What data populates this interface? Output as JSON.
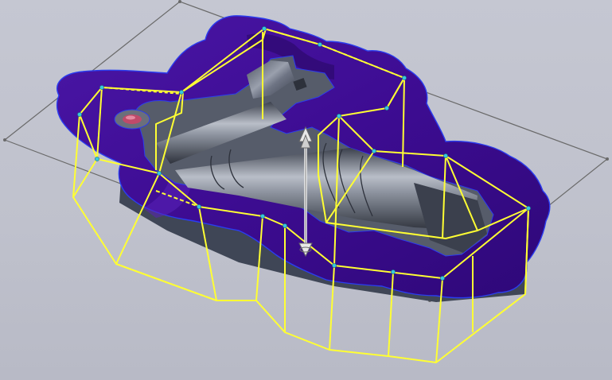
{
  "viewport": {
    "kind": "cad-3d-view",
    "colors": {
      "background": "#c3c5d0",
      "mold_surface": "#3d0c92",
      "mold_surface_light": "#5a23b8",
      "mold_edge": "#2a3df0",
      "cavity_metal": "#5b6271",
      "cavity_metal_light": "#9aa0ad",
      "sketch_lines": "#ffff33",
      "sketch_points": "#36c9e0",
      "bounding_lines": "#6a6a6a",
      "pull_arrow": "#f2f2f2"
    }
  },
  "objects": {
    "mold_block": "mold-surface",
    "cavity": "part-cavity",
    "parting_sketch": "3d-sketch",
    "pull_direction": "double-arrow-icon",
    "bounding_box": "reference-plane"
  }
}
